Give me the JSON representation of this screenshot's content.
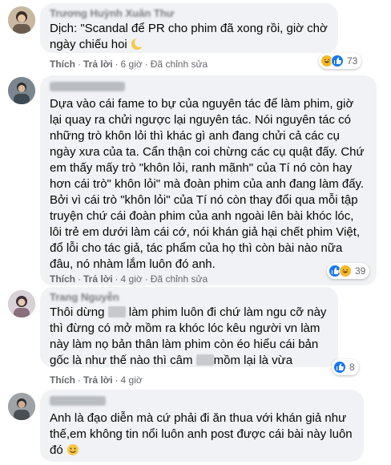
{
  "comments": [
    {
      "author": "Trương Huỳnh Xuân Thư",
      "text": "Dịch: \"Scandal để PR cho phim đã xong rồi, giờ chờ ngày chiếu hoi",
      "emoji": "crescent-moon-emoji",
      "actions": {
        "like": "Thích",
        "reply": "Trả lời",
        "time": "6 giờ",
        "edited": "Đã chỉnh sửa"
      },
      "reactions": {
        "icons": [
          "haha",
          "like"
        ],
        "count": "73"
      }
    },
    {
      "author": "",
      "text": "Dựa vào cái fame to bự của nguyên tác để làm phim, giờ lại quay ra chửi ngược lại nguyên tác. Nói nguyên tác có những trò khôn lỏi thì khác gì anh đang chửi cả các cụ ngày xưa của ta. Cẩn thận coi chừng các cụ quật đấy. Chứ em thấy mấy trò \"khôn lỏi, ranh mãnh\" của Tí nó còn hay hơn cái trò\" khôn lỏi\" mà đoàn phim của anh đang làm đấy. Bởi vì cái trò \"khôn lỏi\" của Tí nó còn thay đổi qua mỗi tập truyện chứ cái đoàn phim của anh ngoài lên bài khóc lóc, lôi trẻ em dưới làm cái cớ, nói khán giả hại chết phim Việt, đổ lỗi cho tác giả, tác phẩm của họ thì còn bài nào nữa đâu, nó nhàm lắm luôn đó anh.",
      "actions": {
        "like": "Thích",
        "reply": "Trả lời",
        "time": "4 giờ",
        "edited": "Đã chỉnh sửa"
      },
      "reactions": {
        "icons": [
          "like",
          "haha"
        ],
        "count": "39"
      }
    },
    {
      "author": "Trang Nguyễn",
      "text_parts": [
        "Thôi dừng ",
        " làm phim luôn đi chứ làm ngu cỡ này thì đừng có mở mồm ra khóc lóc kêu người vn làm này làm nọ bản thân làm phim còn éo hiểu cái bản gốc là như thế nào thì câm ",
        "mồm lại là vừa"
      ],
      "actions": {
        "like": "Thích",
        "reply": "Trả lời",
        "time": "4 giờ"
      },
      "reactions": {
        "icons": [
          "like"
        ],
        "count": "8"
      }
    },
    {
      "author": "",
      "text": "Anh là đạo diễn mà cứ phải đi ăn thua với khán giả như thế,em không tin nổi luôn anh post được cái bài này luôn đó",
      "emoji": "smile-emoji"
    }
  ],
  "colors": {
    "like": "#1877f2",
    "haha": "#f7b928",
    "bubble": "#f0f2f5",
    "muted": "#65676b"
  }
}
